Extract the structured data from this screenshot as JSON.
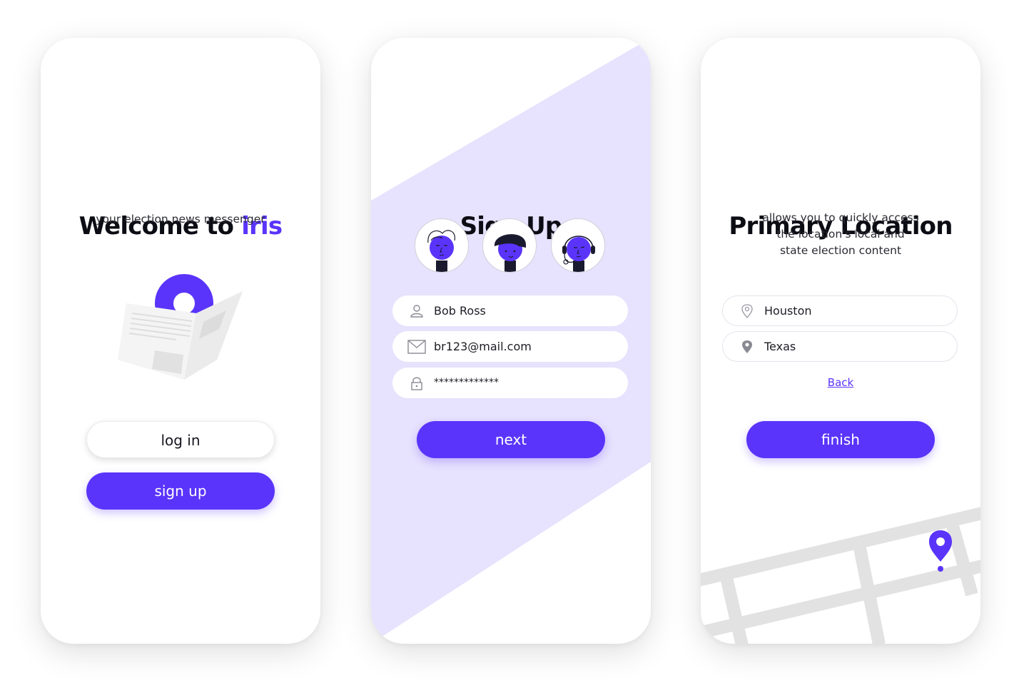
{
  "theme": {
    "accent": "#5a34fa",
    "accent_light": "#e7e2fd",
    "map_gray": "#e2e2e2"
  },
  "screen_welcome": {
    "title_prefix": "Welcome to",
    "title_brand": "iris",
    "subtitle": "your election news messenger",
    "illustration_icon": "newspaper-logo-icon",
    "login_label": "log in",
    "signup_label": "sign up"
  },
  "screen_signup": {
    "title": "Sign Up",
    "avatars": [
      {
        "icon": "avatar-curly-hair-icon"
      },
      {
        "icon": "avatar-cap-icon"
      },
      {
        "icon": "avatar-headset-icon"
      }
    ],
    "fields": {
      "name": {
        "icon": "user-icon",
        "value": "Bob Ross"
      },
      "email": {
        "icon": "mail-icon",
        "value": "br123@mail.com"
      },
      "password": {
        "icon": "lock-icon",
        "value": "*************"
      }
    },
    "next_label": "next"
  },
  "screen_location": {
    "title": "Primary Location",
    "subtitle_lines": [
      "allows you to quickly access",
      "the location's local and",
      "state election content"
    ],
    "fields": {
      "city": {
        "icon": "location-pin-outline-icon",
        "value": "Houston"
      },
      "state": {
        "icon": "location-pin-filled-icon",
        "value": "Texas"
      }
    },
    "back_label": "Back",
    "finish_label": "finish",
    "map_icon": "map-pin-icon"
  }
}
